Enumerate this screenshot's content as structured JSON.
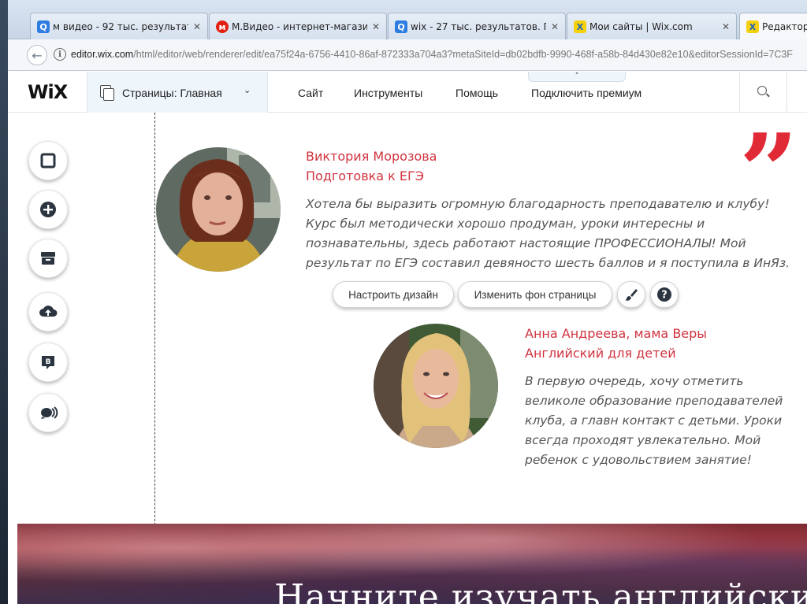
{
  "browser": {
    "tabs": [
      {
        "label": "м видео - 92 тыс. результат",
        "icon": "search-favicon-icon"
      },
      {
        "label": "М.Видео - интернет-магази",
        "icon": "mvideo-favicon-icon"
      },
      {
        "label": "wix - 27 тыс. результатов. П",
        "icon": "search-favicon-icon"
      },
      {
        "label": "Мои сайты | Wix.com",
        "icon": "wix-favicon-icon"
      },
      {
        "label": "Редактор",
        "icon": "wix-favicon-icon"
      }
    ],
    "close_glyph": "✕",
    "url_host": "editor.wix.com",
    "url_rest": "/html/editor/web/renderer/edit/ea75f24a-6756-4410-86af-872333a704a3?metaSiteId=db02bdfb-9990-468f-a58b-84d430e82e10&editorSessionId=7C3F"
  },
  "editor": {
    "logo": "WiX",
    "pages_label": "Страницы: Главная",
    "menu": {
      "site": "Сайт",
      "tools": "Инструменты",
      "help": "Помощь",
      "premium": "Подключить премиум"
    },
    "collapse_glyph": "˄",
    "tools": [
      "background-icon",
      "add-icon",
      "app-market-icon",
      "upload-icon",
      "blog-icon",
      "chat-icon"
    ]
  },
  "testimonials": [
    {
      "name": "Виктория Морозова",
      "course": "Подготовка к ЕГЭ",
      "text": "Хотела бы выразить огромную благодарность преподавателю и клубу! Курс был методически хорошо продуман, уроки интересны и познавательны, здесь работают настоящие  ПРОФЕССИОНАЛЫ! Мой результат по ЕГЭ составил девяносто шесть баллов и я поступила в ИнЯз."
    },
    {
      "name": "Анна Андреева, мама Веры",
      "course": "Английский для детей",
      "text": "В первую очередь, хочу отметить великоле образование преподавателей клуба, а главн контакт с детьми. Уроки всегда проходят увлекательно. Мой ребенок с удовольствием занятие!"
    }
  ],
  "quote_glyph": "”",
  "controls": {
    "design": "Настроить дизайн",
    "background": "Изменить фон страницы"
  },
  "banner": {
    "title": "Начните изучать английский"
  },
  "colors": {
    "accent_red": "#d0333f",
    "quote_red": "#e02a36"
  }
}
